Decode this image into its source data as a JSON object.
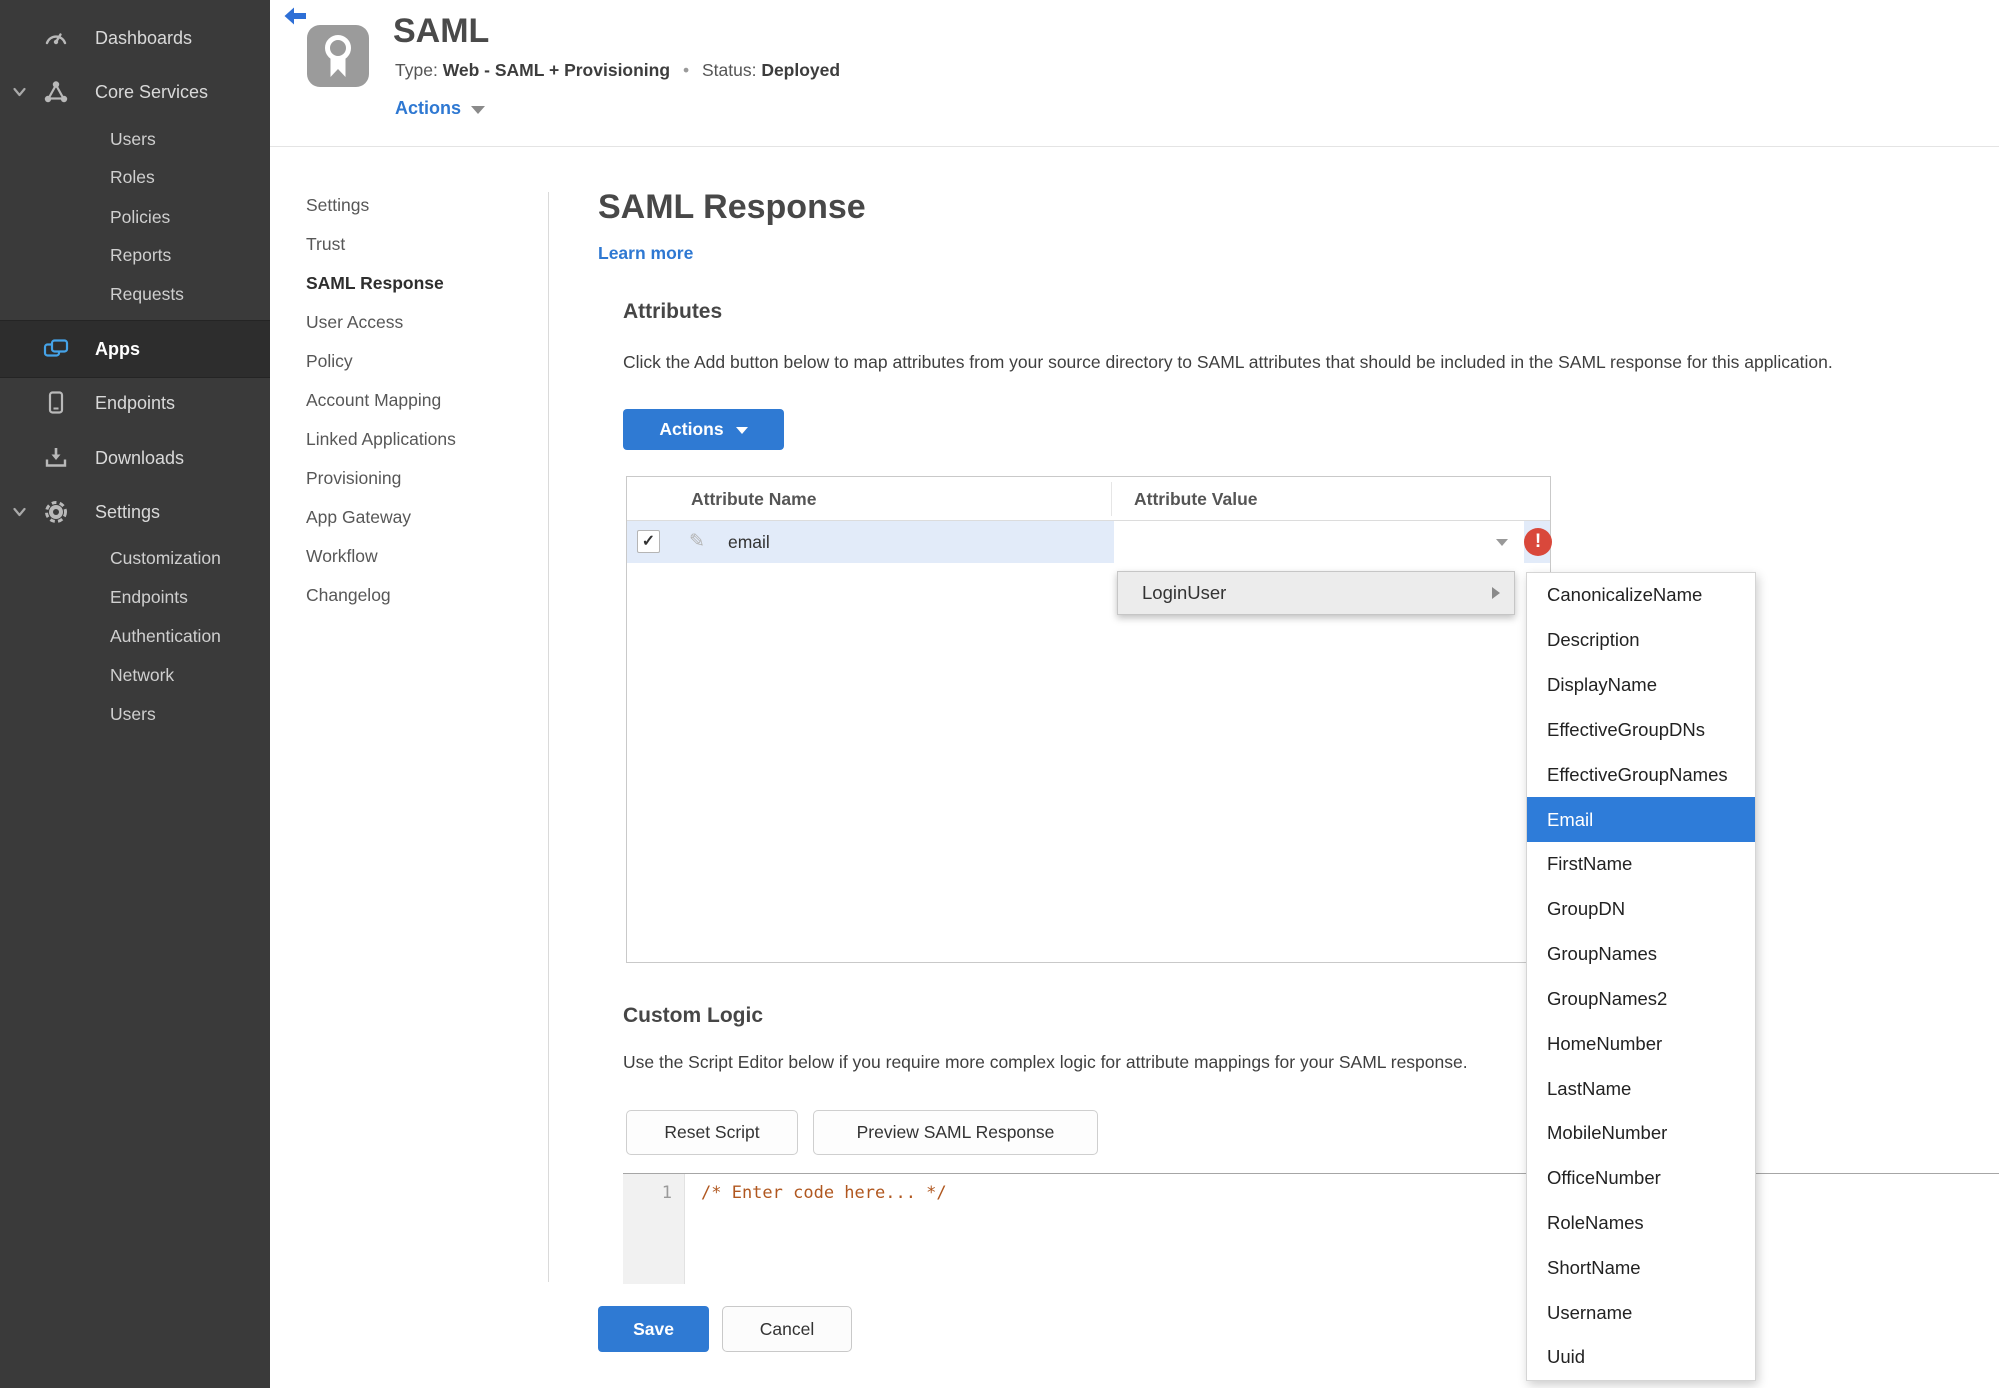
{
  "colors": {
    "accent_blue": "#2f7ad3",
    "link_blue": "#2e78d2",
    "status_green": "#3e8e2f",
    "error_red": "#d9483b",
    "selection_blue": "#2e7cd9",
    "sidebar_bg": "#3a3a3a",
    "row_highlight": "#e2ebf9"
  },
  "icons": {
    "checkbox_check": "✓",
    "pencil": "✎"
  },
  "sidebar": {
    "items": [
      {
        "label": "Dashboards"
      },
      {
        "label": "Core Services"
      },
      {
        "label": "Users"
      },
      {
        "label": "Roles"
      },
      {
        "label": "Policies"
      },
      {
        "label": "Reports"
      },
      {
        "label": "Requests"
      },
      {
        "label": "Apps"
      },
      {
        "label": "Endpoints"
      },
      {
        "label": "Downloads"
      },
      {
        "label": "Settings"
      },
      {
        "label": "Customization"
      },
      {
        "label": "Endpoints"
      },
      {
        "label": "Authentication"
      },
      {
        "label": "Network"
      },
      {
        "label": "Users"
      }
    ],
    "active_item": "Apps"
  },
  "header": {
    "app_title": "SAML",
    "type_label": "Type:",
    "type_value": "Web - SAML + Provisioning",
    "dot": "•",
    "status_label": "Status:",
    "status_value": "Deployed",
    "actions_label": "Actions"
  },
  "subnav": {
    "items": [
      "Settings",
      "Trust",
      "SAML Response",
      "User Access",
      "Policy",
      "Account Mapping",
      "Linked Applications",
      "Provisioning",
      "App Gateway",
      "Workflow",
      "Changelog"
    ],
    "active_item": "SAML Response"
  },
  "main": {
    "title": "SAML Response",
    "learn_more_label": "Learn more",
    "attributes": {
      "heading": "Attributes",
      "description": "Click the Add button below to map attributes from your source directory to SAML attributes that should be included in the SAML response for this application.",
      "actions_button_label": "Actions",
      "table": {
        "columns": [
          "Attribute Name",
          "Attribute Value"
        ],
        "rows": [
          {
            "checked": true,
            "name": "email",
            "value": "",
            "has_error": true
          }
        ]
      }
    },
    "value_dropdown": {
      "root_item": "LoginUser",
      "submenu_items": [
        "CanonicalizeName",
        "Description",
        "DisplayName",
        "EffectiveGroupDNs",
        "EffectiveGroupNames",
        "Email",
        "FirstName",
        "GroupDN",
        "GroupNames",
        "GroupNames2",
        "HomeNumber",
        "LastName",
        "MobileNumber",
        "OfficeNumber",
        "RoleNames",
        "ShortName",
        "Username",
        "Uuid"
      ],
      "selected_item": "Email"
    },
    "custom_logic": {
      "heading": "Custom Logic",
      "description": "Use the Script Editor below if you require more complex logic for attribute mappings for your SAML response.",
      "reset_button_label": "Reset Script",
      "preview_button_label": "Preview SAML Response",
      "editor": {
        "line_number": "1",
        "code": "/* Enter code here... */"
      }
    },
    "footer": {
      "save_label": "Save",
      "cancel_label": "Cancel"
    }
  }
}
